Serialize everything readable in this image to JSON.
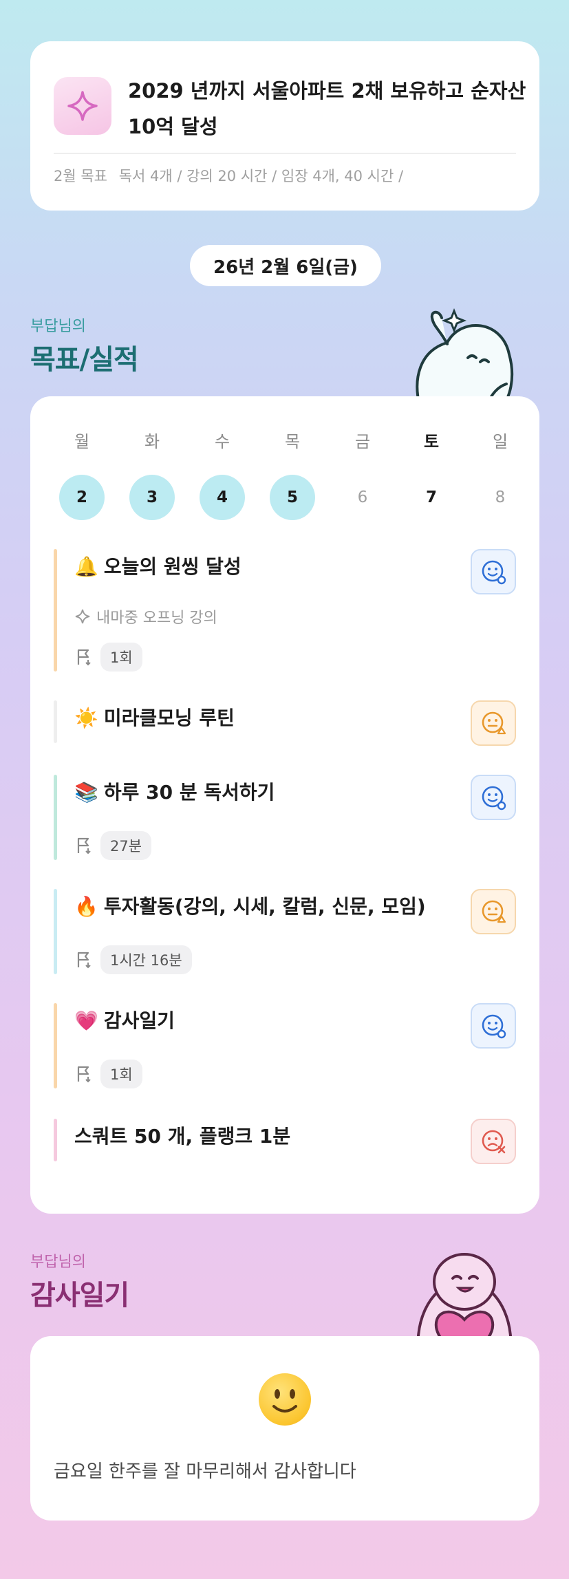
{
  "goal": {
    "icon": "sparkle-icon",
    "title": "2029 년까지 서울아파트 2채 보유하고 순자산 10억 달성",
    "monthly_label": "2월 목표",
    "monthly_items": "독서 4개 / 강의 20 시간 / 임장 4개, 40 시간 /"
  },
  "date_label": "26년 2월 6일(금)",
  "goals_section": {
    "owner": "부답님의",
    "title": "목표/실적"
  },
  "week": {
    "days": [
      "월",
      "화",
      "수",
      "목",
      "금",
      "토",
      "일"
    ],
    "dates": [
      "2",
      "3",
      "4",
      "5",
      "6",
      "7",
      "8"
    ],
    "completed": [
      "2",
      "3",
      "4",
      "5"
    ],
    "bold": [
      "토",
      "7"
    ]
  },
  "tasks": [
    {
      "emoji": "🔔",
      "title": "오늘의 원씽 달성",
      "sub": "내마중 오프닝 강의",
      "record": "1회",
      "status": "good",
      "bar_color": "#f9d6aa"
    },
    {
      "emoji": "☀️",
      "title": "미라클모닝 루틴",
      "record": "",
      "status": "mid",
      "bar_color": "#eeeeee"
    },
    {
      "emoji": "📚",
      "title": "하루 30 분 독서하기",
      "record": "27분",
      "status": "good",
      "bar_color": "#bfe9dc"
    },
    {
      "emoji": "🔥",
      "title": "투자활동(강의, 시세, 칼럼, 신문, 모임)",
      "record": "1시간 16분",
      "status": "mid",
      "bar_color": "#c9ecf3"
    },
    {
      "emoji": "💗",
      "title": "감사일기",
      "record": "1회",
      "status": "good",
      "bar_color": "#f9d6aa"
    },
    {
      "emoji": "",
      "title": "스쿼트 50 개, 플랭크 1분",
      "record": "",
      "status": "bad",
      "bar_color": "#f5c9de"
    }
  ],
  "diary_section": {
    "owner": "부답님의",
    "title": "감사일기"
  },
  "diary": {
    "emoji": "slightly-smiling-face",
    "text": "금요일 한주를 잘 마무리해서 감사합니다"
  },
  "colors": {
    "good": "#2f6fd6",
    "mid": "#e8982c",
    "bad": "#e05a4f",
    "goals_heading": "#1c6e72",
    "diary_heading": "#8a2f73"
  }
}
